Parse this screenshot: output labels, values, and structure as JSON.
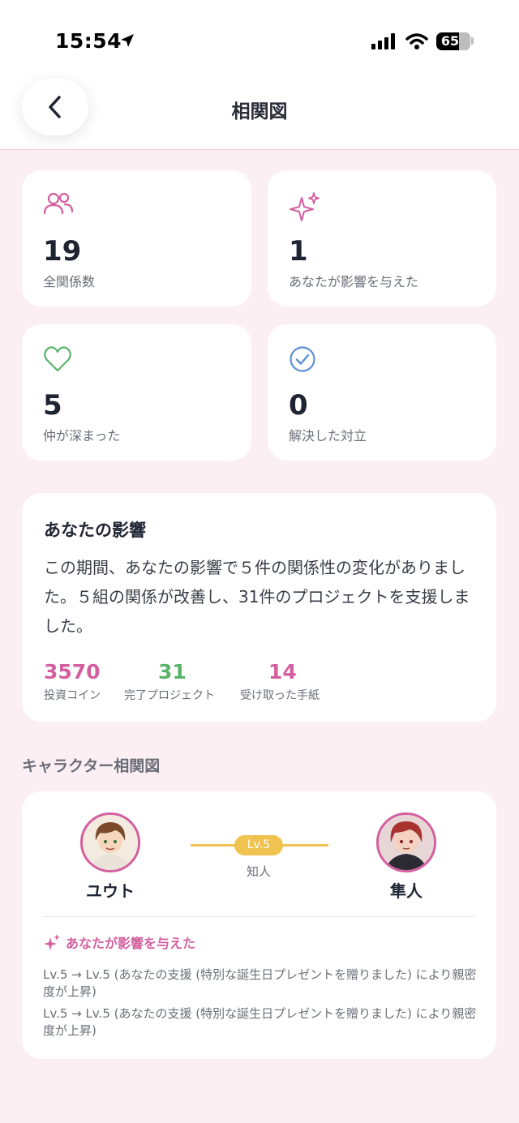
{
  "status_bar": {
    "time": "15:54",
    "battery": "65"
  },
  "header": {
    "title": "相関図"
  },
  "stats": [
    {
      "icon": "people-icon",
      "value": "19",
      "label": "全関係数"
    },
    {
      "icon": "sparkles-icon",
      "value": "1",
      "label": "あなたが影響を与えた"
    },
    {
      "icon": "heart-icon",
      "value": "5",
      "label": "仲が深まった"
    },
    {
      "icon": "check-circle-icon",
      "value": "0",
      "label": "解決した対立"
    }
  ],
  "influence": {
    "title": "あなたの影響",
    "body": "この期間、あなたの影響で５件の関係性の変化がありました。５組の関係が改善し、31件のプロジェクトを支援しました。",
    "metrics": [
      {
        "value": "3570",
        "label": "投資コイン",
        "color": "#d45fa0"
      },
      {
        "value": "31",
        "label": "完了プロジェクト",
        "color": "#5bb36a"
      },
      {
        "value": "14",
        "label": "受け取った手紙",
        "color": "#d45fa0"
      }
    ]
  },
  "relationship_section": {
    "title": "キャラクター相関図",
    "left_character": "ユウト",
    "right_character": "隼人",
    "level": "Lv.5",
    "relation": "知人",
    "influence_label": "あなたが影響を与えた",
    "logs": [
      "Lv.5 → Lv.5 (あなたの支援 (特別な誕生日プレゼントを贈りました) により親密度が上昇)",
      "Lv.5 → Lv.5 (あなたの支援 (特別な誕生日プレゼントを贈りました) により親密度が上昇)"
    ]
  },
  "colors": {
    "accent_pink": "#d45fa0",
    "accent_green": "#5bb36a",
    "level_gold": "#f0c24f",
    "background": "#fbeff4"
  }
}
